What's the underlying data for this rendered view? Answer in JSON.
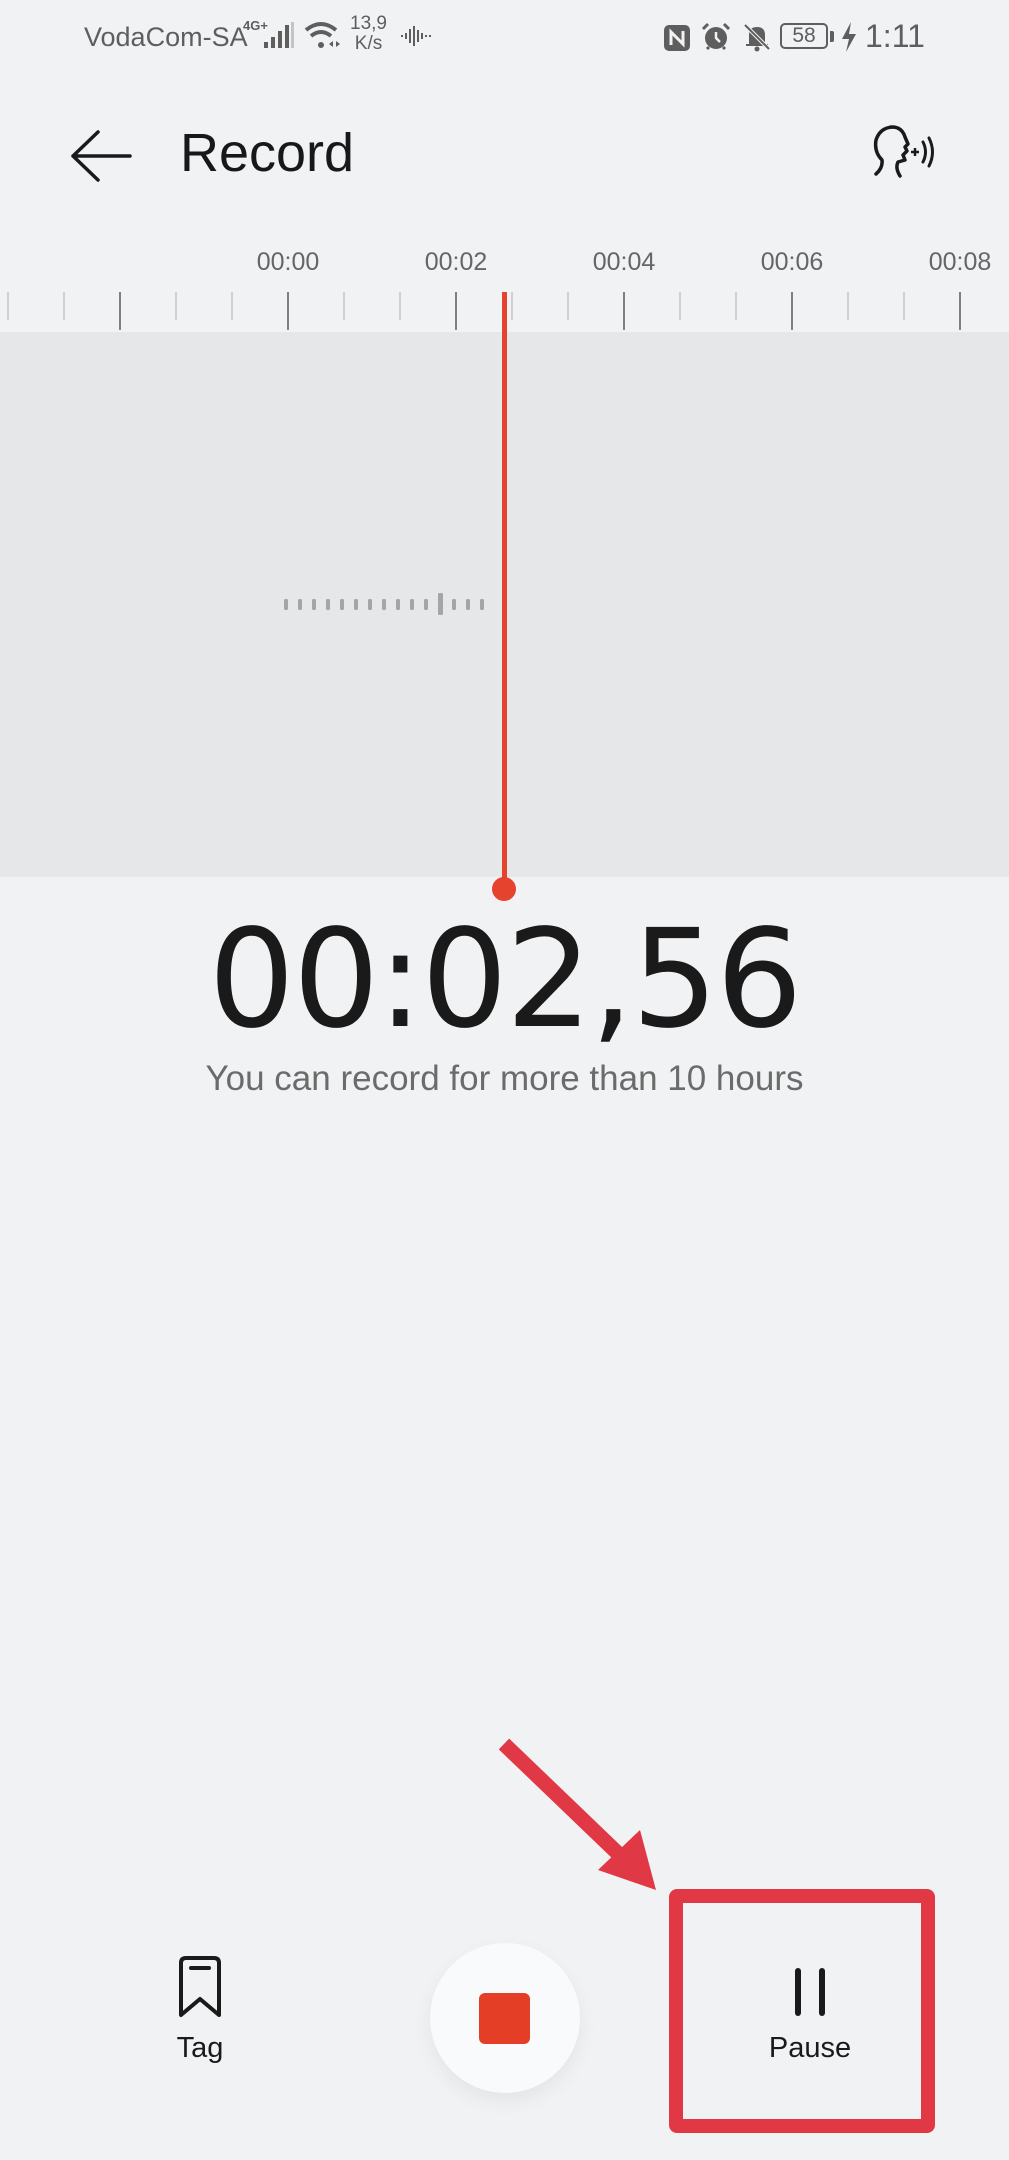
{
  "status_bar": {
    "carrier": "VodaCom-SA",
    "network_type": "4G+",
    "data_speed_value": "13,9",
    "data_speed_unit": "K/s",
    "battery_level": "58",
    "time": "1:11",
    "icons": [
      "signal-icon",
      "wifi-icon",
      "voice-activity-icon",
      "nfc-icon",
      "alarm-icon",
      "mute-bell-icon",
      "battery-icon",
      "charging-bolt-icon"
    ]
  },
  "header": {
    "title": "Record",
    "back_icon": "arrow-left-icon",
    "voice_icon": "speaking-head-icon"
  },
  "timeline": {
    "tick_labels": [
      "00:00",
      "00:02",
      "00:04",
      "00:06",
      "00:08"
    ],
    "playhead_seconds": 2.56,
    "playhead_color": "#e5432d"
  },
  "recording": {
    "elapsed": "00:02,56",
    "hint": "You can record for more than 10 hours"
  },
  "controls": {
    "tag_label": "Tag",
    "tag_icon": "bookmark-icon",
    "stop_icon": "stop-square-icon",
    "stop_color": "#e53e26",
    "pause_label": "Pause",
    "pause_icon": "pause-icon"
  },
  "annotation": {
    "target": "Pause",
    "color": "#e13845"
  }
}
